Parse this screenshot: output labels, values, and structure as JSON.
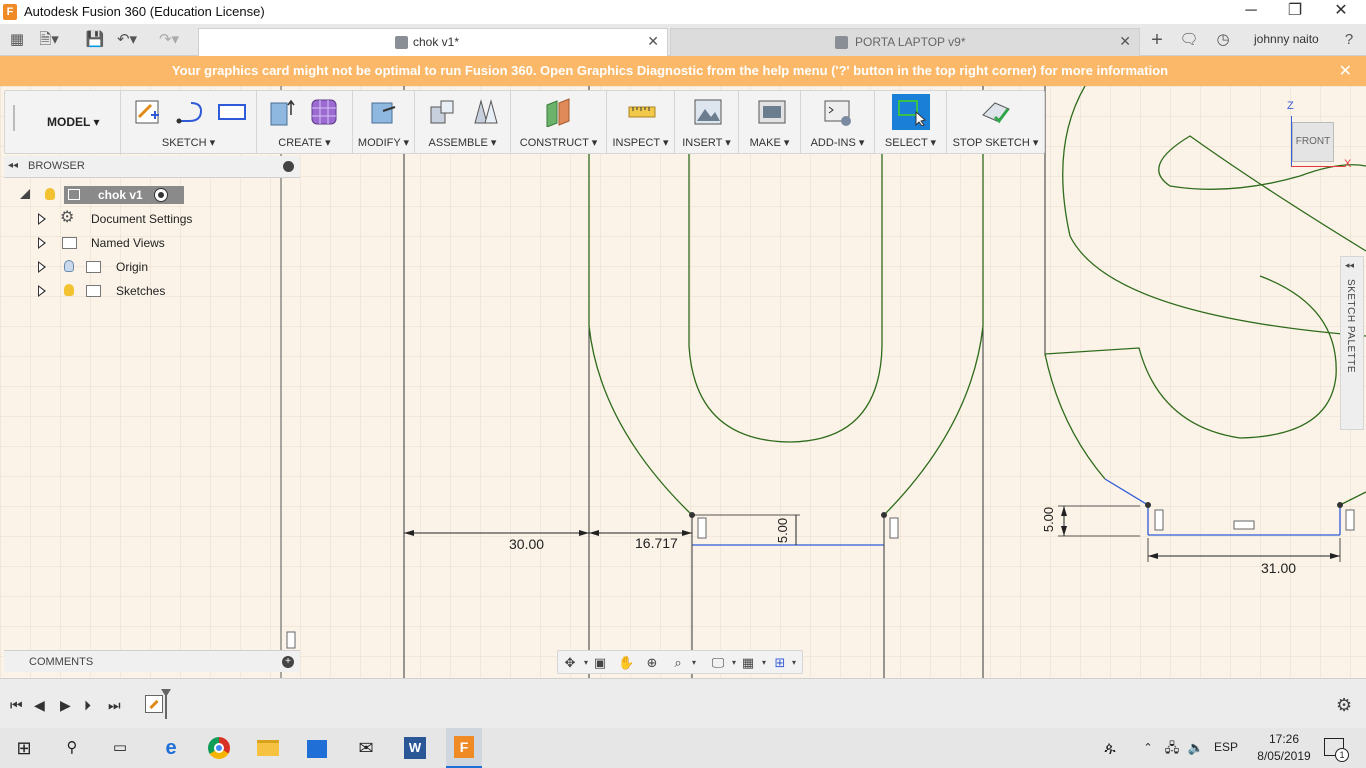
{
  "window": {
    "title": "Autodesk Fusion 360 (Education License)",
    "app_icon_letter": "F",
    "minimize": "─",
    "restore": "❐",
    "close": "✕"
  },
  "tabs": [
    {
      "label": "chok v1*",
      "active": true,
      "close": "✕"
    },
    {
      "label": "PORTA LAPTOP v9*",
      "active": false,
      "close": "✕"
    }
  ],
  "header": {
    "user": "johnny naito",
    "add_tab": "+",
    "help": "?"
  },
  "banner": {
    "message": "Your graphics card might not be optimal to run Fusion 360. Open Graphics Diagnostic from the help menu ('?' button in the top right corner) for more information",
    "close": "✕"
  },
  "toolbar": {
    "workspace": "MODEL ▾",
    "groups": [
      {
        "label": "SKETCH ▾"
      },
      {
        "label": "CREATE ▾"
      },
      {
        "label": "MODIFY ▾"
      },
      {
        "label": "ASSEMBLE ▾"
      },
      {
        "label": "CONSTRUCT ▾"
      },
      {
        "label": "INSPECT ▾"
      },
      {
        "label": "INSERT ▾"
      },
      {
        "label": "MAKE ▾"
      },
      {
        "label": "ADD-INS ▾"
      },
      {
        "label": "SELECT ▾"
      },
      {
        "label": "STOP SKETCH ▾"
      }
    ]
  },
  "browser": {
    "title": "BROWSER",
    "collapse": "◂◂",
    "root": "chok v1",
    "items": [
      {
        "label": "Document Settings"
      },
      {
        "label": "Named Views"
      },
      {
        "label": "Origin"
      },
      {
        "label": "Sketches"
      }
    ]
  },
  "comments": {
    "title": "COMMENTS"
  },
  "viewcube": {
    "face": "FRONT",
    "axis_z": "Z",
    "axis_x": "X"
  },
  "palette": {
    "title": "SKETCH PALETTE",
    "collapse": "◂◂"
  },
  "dimensions": {
    "d1": "30.00",
    "d2": "16.717",
    "d3": "5.00",
    "d4": "5.00",
    "d5": "31.00"
  },
  "taskbar": {
    "language": "ESP",
    "time": "17:26",
    "date": "8/05/2019",
    "notifications": "1"
  },
  "colors": {
    "banner": "#fbb869",
    "canvas": "#fbf3e8",
    "sketch_profile": "#2e6b1a",
    "constraint_line": "#2f5bd8",
    "select_active": "#1a7fd6",
    "app_orange": "#f08a24"
  }
}
